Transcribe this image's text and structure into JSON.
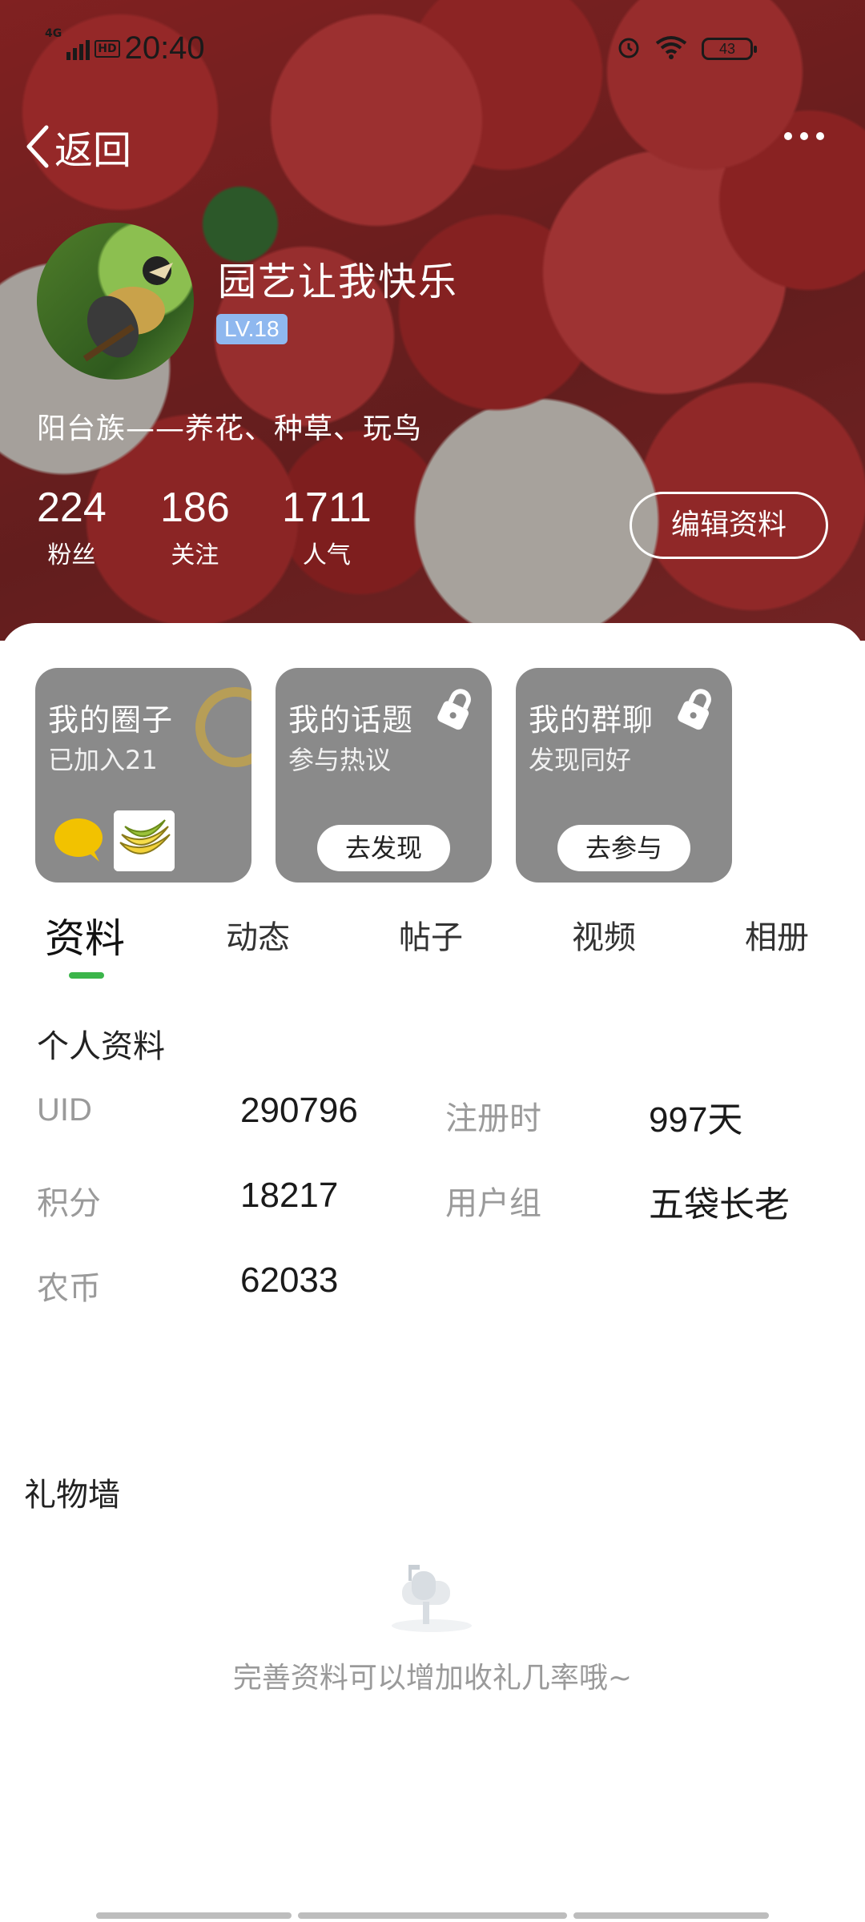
{
  "status_bar": {
    "network": "4G",
    "hd": "HD",
    "time": "20:40",
    "battery": "43",
    "icons": [
      "alarm-icon",
      "wifi-icon",
      "battery-icon"
    ]
  },
  "nav": {
    "back_label": "返回",
    "more_icon": "more-dots-icon"
  },
  "profile": {
    "nickname": "园艺让我快乐",
    "level": "LV.18",
    "bio": "阳台族——养花、种草、玩鸟",
    "stats": [
      {
        "value": "224",
        "label": "粉丝"
      },
      {
        "value": "186",
        "label": "关注"
      },
      {
        "value": "1711",
        "label": "人气"
      }
    ],
    "edit_button": "编辑资料"
  },
  "cards": [
    {
      "title": "我的圈子",
      "subtitle": "已加入21"
    },
    {
      "title": "我的话题",
      "subtitle": "参与热议",
      "button": "去发现",
      "icon": "lock-icon"
    },
    {
      "title": "我的群聊",
      "subtitle": "发现同好",
      "button": "去参与",
      "icon": "lock-icon"
    }
  ],
  "tabs": [
    {
      "label": "资料",
      "active": true
    },
    {
      "label": "动态",
      "active": false
    },
    {
      "label": "帖子",
      "active": false
    },
    {
      "label": "视频",
      "active": false
    },
    {
      "label": "相册",
      "active": false
    }
  ],
  "personal_info": {
    "title": "个人资料",
    "fields": [
      {
        "label": "UID",
        "value": "290796"
      },
      {
        "label": "注册时",
        "value": "997天"
      },
      {
        "label": "积分",
        "value": "18217"
      },
      {
        "label": "用户组",
        "value": "五袋长老"
      },
      {
        "label": "农币",
        "value": "62033"
      }
    ]
  },
  "gift_wall": {
    "title": "礼物墙",
    "empty_hint": "完善资料可以增加收礼几率哦~"
  },
  "colors": {
    "accent": "#3bb54a",
    "level_badge": "#8fb8ef",
    "card_bg": "#8a8a8a"
  }
}
